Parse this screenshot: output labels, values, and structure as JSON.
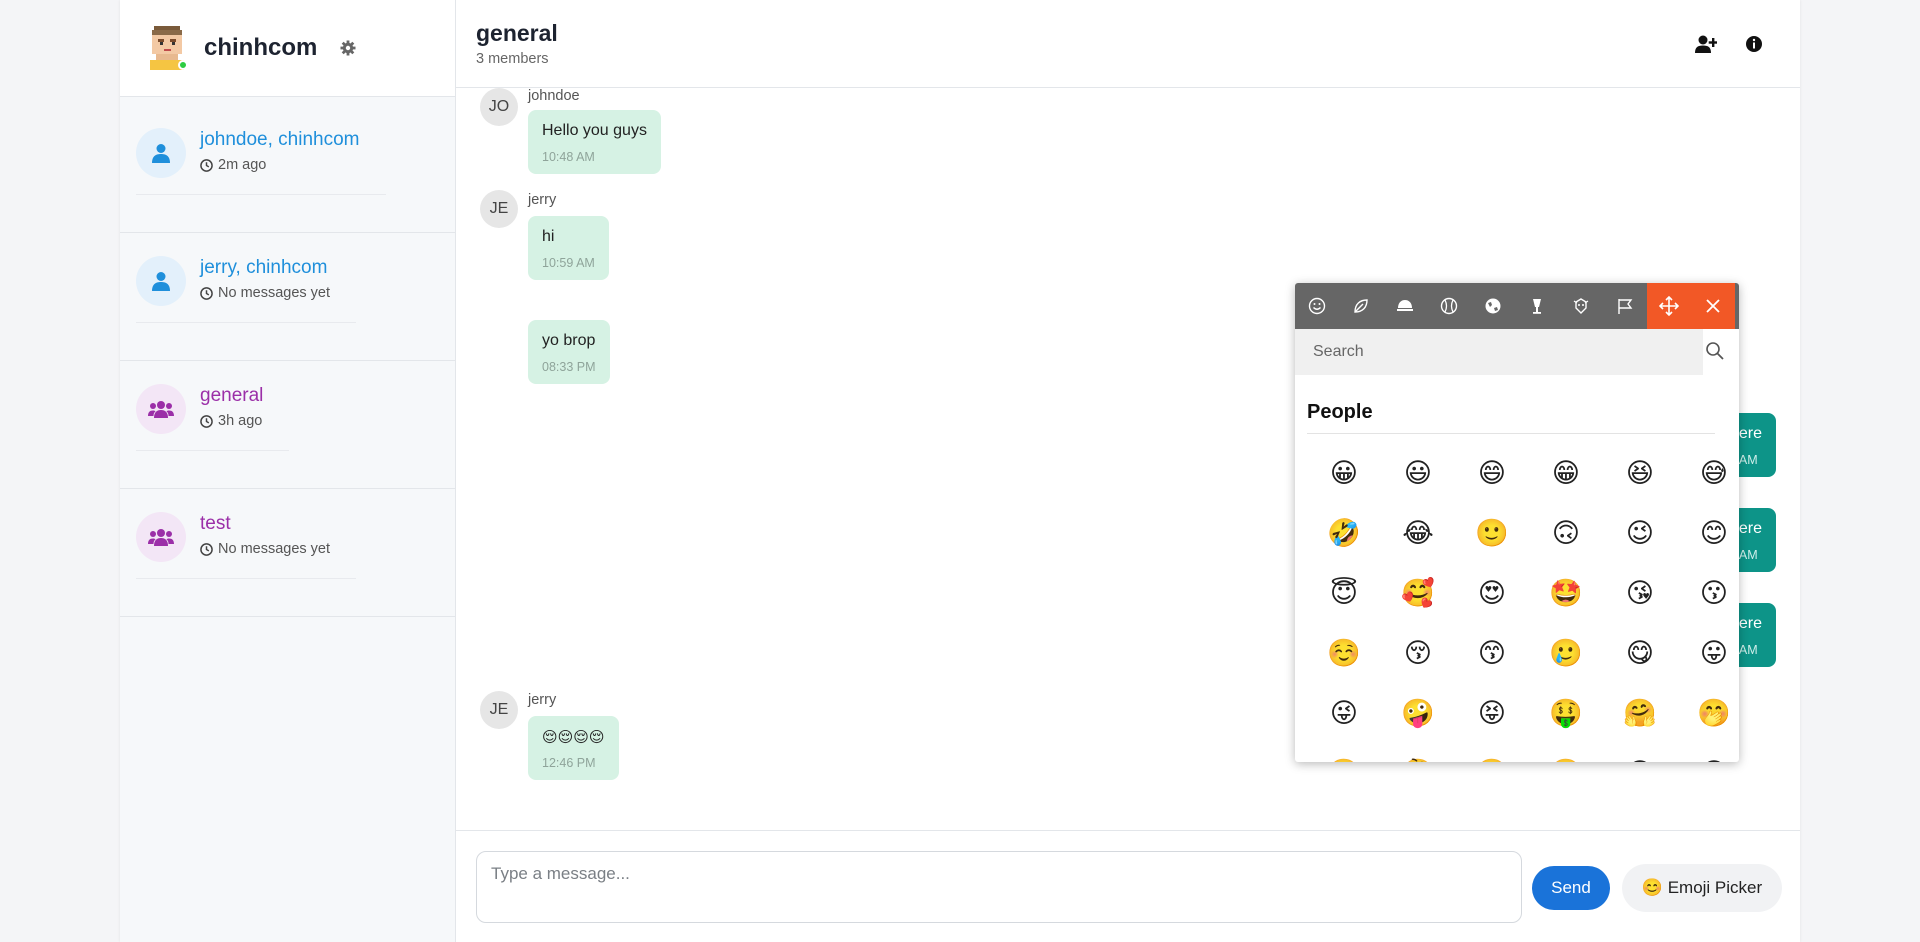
{
  "user": {
    "name": "chinhcom",
    "status": "online"
  },
  "conversations": [
    {
      "name": "johndoe, chinhcom",
      "time": "2m ago",
      "type": "direct"
    },
    {
      "name": "jerry, chinhcom",
      "time": "No messages yet",
      "type": "direct"
    },
    {
      "name": "general",
      "time": "3h ago",
      "type": "group"
    },
    {
      "name": "test",
      "time": "No messages yet",
      "type": "group"
    }
  ],
  "chat": {
    "title": "general",
    "subtitle": "3 members",
    "messages": [
      {
        "initials": "JO",
        "sender": "johndoe",
        "text": "Hello you guys",
        "time": "10:48 AM"
      },
      {
        "initials": "JE",
        "sender": "jerry",
        "text": "hi",
        "time": "10:59 AM"
      },
      {
        "text": "yo brop",
        "time": "08:33 PM"
      },
      {
        "initials": "JE",
        "sender": "jerry",
        "text": "😌😌😌😌",
        "time": "12:46 PM"
      }
    ],
    "outgoing": [
      {
        "text": "ere",
        "time": "AM"
      },
      {
        "text": "ere",
        "time": "AM"
      },
      {
        "text": "ere",
        "time": "AM"
      }
    ]
  },
  "composer": {
    "placeholder": "Type a message...",
    "send_label": "Send",
    "emoji_label": "😊 Emoji Picker"
  },
  "emoji_picker": {
    "search_placeholder": "Search",
    "section": "People",
    "tabs": [
      "people",
      "nature",
      "food",
      "activity",
      "travel",
      "objects",
      "symbols",
      "flags",
      "move",
      "close"
    ],
    "emojis": [
      "😀",
      "😃",
      "😄",
      "😁",
      "😆",
      "😅",
      "🤣",
      "😂",
      "🙂",
      "🙃",
      "😉",
      "😊",
      "😇",
      "🥰",
      "😍",
      "🤩",
      "😘",
      "😗",
      "☺️",
      "😚",
      "😙",
      "🥲",
      "😋",
      "😛",
      "😜",
      "🤪",
      "😝",
      "🤑",
      "🤗",
      "🤭",
      "🤫",
      "🤔",
      "🤐",
      "🤨",
      "😐",
      "😑"
    ]
  },
  "colors": {
    "accent": "#1a73d9",
    "direct": "#1f8fdb",
    "group": "#9b2fa8",
    "incoming_bubble": "#d6f2e4",
    "outgoing_bubble": "#0d9488",
    "picker_accent": "#f25826"
  }
}
